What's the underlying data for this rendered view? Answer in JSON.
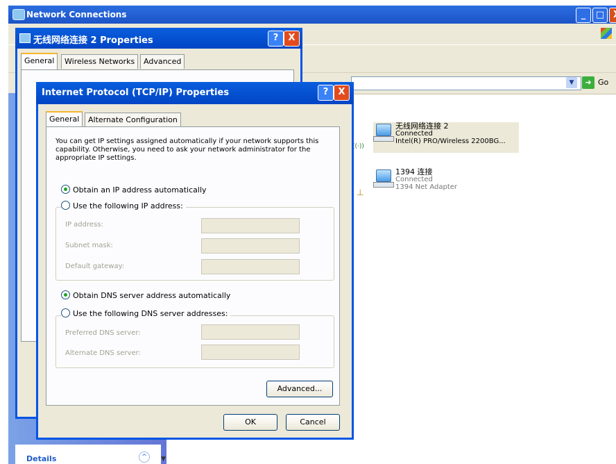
{
  "network_connections": {
    "title": "Network Connections",
    "go_label": "Go",
    "connections": [
      {
        "name": "无线网络连接 2",
        "status": "Connected",
        "adapter": "Intel(R) PRO/Wireless 2200BG..."
      },
      {
        "name": "1394 连接",
        "status": "Connected",
        "adapter": "1394 Net Adapter"
      }
    ],
    "details_label": "Details",
    "title_buttons": {
      "minimize": "_",
      "maximize": "□",
      "close": "X"
    }
  },
  "wireless_properties": {
    "title": "无线网络连接 2 Properties",
    "tabs": [
      "General",
      "Wireless Networks",
      "Advanced"
    ],
    "help": "?",
    "close": "X"
  },
  "tcpip": {
    "title": "Internet Protocol (TCP/IP) Properties",
    "tabs": [
      "General",
      "Alternate Configuration"
    ],
    "intro": "You can get IP settings assigned automatically if your network supports this capability. Otherwise, you need to ask your network administrator for the appropriate IP settings.",
    "ip_auto": "Obtain an IP address automatically",
    "ip_manual": "Use the following IP address:",
    "ip_address_label": "IP address:",
    "subnet_label": "Subnet mask:",
    "gateway_label": "Default gateway:",
    "dns_auto": "Obtain DNS server address automatically",
    "dns_manual": "Use the following DNS server addresses:",
    "preferred_dns_label": "Preferred DNS server:",
    "alternate_dns_label": "Alternate DNS server:",
    "advanced_button": "Advanced...",
    "ok_button": "OK",
    "cancel_button": "Cancel",
    "help": "?",
    "close": "X"
  }
}
